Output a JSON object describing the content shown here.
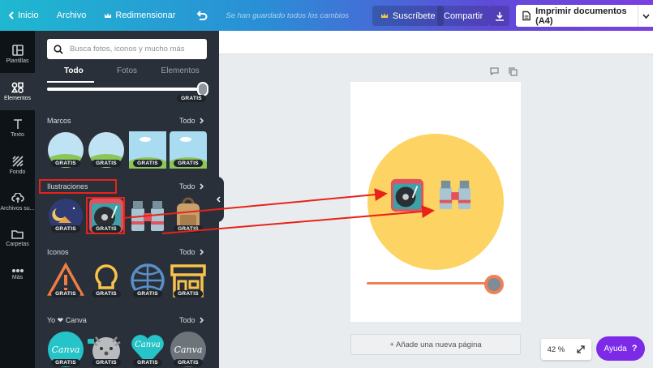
{
  "topbar": {
    "home_label": "Inicio",
    "file_label": "Archivo",
    "resize_label": "Redimensionar",
    "save_status": "Se han guardado todos los cambios",
    "subscribe_label": "Suscríbete",
    "share_label": "Compartir",
    "print_label": "Imprimir documentos (A4)"
  },
  "rail": {
    "items": [
      {
        "label": "Plantillas",
        "icon": "templates-icon"
      },
      {
        "label": "Elementos",
        "icon": "elements-icon"
      },
      {
        "label": "Texto",
        "icon": "text-icon"
      },
      {
        "label": "Fondo",
        "icon": "background-icon"
      },
      {
        "label": "Archivos su...",
        "icon": "upload-icon"
      },
      {
        "label": "Carpetas",
        "icon": "folder-icon"
      },
      {
        "label": "Más",
        "icon": "more-icon"
      }
    ],
    "active": "Elementos"
  },
  "panel": {
    "search_placeholder": "Busca fotos, iconos y mucho más",
    "tabs": [
      "Todo",
      "Fotos",
      "Elementos"
    ],
    "badge": "GRATIS",
    "see_all": "Todo",
    "sections": [
      {
        "title": "Marcos"
      },
      {
        "title": "Ilustraciones"
      },
      {
        "title": "Iconos"
      },
      {
        "title": "Yo ❤ Canva"
      }
    ],
    "canva_label": "Canva"
  },
  "canvas": {
    "add_page_label": "+ Añade una nueva página",
    "zoom_label": "42 %",
    "help_label": "Ayuda",
    "help_mark": "?",
    "slider_value": 0.95
  },
  "colors": {
    "accent_purple": "#7d2ae8",
    "circle_yellow": "#fdd463",
    "slider_orange": "#f08156",
    "highlight_red": "#e8231a",
    "panel_dark": "#293039"
  }
}
